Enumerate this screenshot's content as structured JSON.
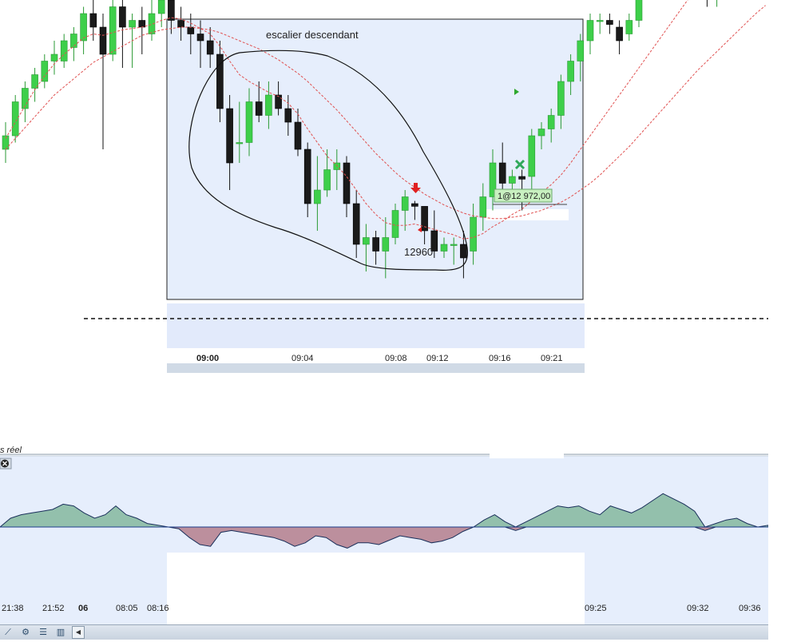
{
  "annotations": {
    "title": "escalier descendant",
    "price_label": "12960",
    "order_tag": "1@12 972,00"
  },
  "indicator": {
    "label": "s réel"
  },
  "toolbar": {
    "icons": [
      "line-tool-icon",
      "settings-icon",
      "list-icon",
      "bars-icon",
      "scroll-left-icon"
    ]
  },
  "colors": {
    "bull": "#3ecf4a",
    "bear": "#1a1a1a",
    "ma": "#e05050",
    "area_pos": "#4f9a6a",
    "area_neg": "#a0505e",
    "panel_bg": "#e6eefc"
  },
  "chart_data": [
    {
      "type": "candlestick",
      "x_top": [
        "09:00",
        "09:04",
        "09:08",
        "09:12",
        "09:16",
        "09:21"
      ],
      "x_bottom": [
        "21:38",
        "21:52",
        "06",
        "08:05",
        "08:16",
        "09:25",
        "09:32",
        "09:36"
      ],
      "ylim": [
        12900,
        13100
      ],
      "candles": [
        [
          12990,
          13010,
          12980,
          13000
        ],
        [
          13000,
          13030,
          12995,
          13025
        ],
        [
          13020,
          13040,
          13010,
          13035
        ],
        [
          13035,
          13050,
          13025,
          13045
        ],
        [
          13040,
          13060,
          13035,
          13055
        ],
        [
          13055,
          13070,
          13045,
          13060
        ],
        [
          13055,
          13075,
          13050,
          13070
        ],
        [
          13065,
          13080,
          13055,
          13075
        ],
        [
          13070,
          13095,
          13060,
          13090
        ],
        [
          13090,
          13100,
          13070,
          13080
        ],
        [
          13080,
          13090,
          12990,
          13060
        ],
        [
          13060,
          13100,
          13055,
          13095
        ],
        [
          13095,
          13105,
          13050,
          13080
        ],
        [
          13080,
          13090,
          13050,
          13085
        ],
        [
          13085,
          13095,
          13060,
          13080
        ],
        [
          13075,
          13100,
          13070,
          13090
        ],
        [
          13090,
          13105,
          13080,
          13100
        ],
        [
          13100,
          13110,
          13075,
          13085
        ],
        [
          13085,
          13095,
          13070,
          13080
        ],
        [
          13080,
          13090,
          13060,
          13075
        ],
        [
          13075,
          13085,
          13050,
          13070
        ],
        [
          13070,
          13080,
          13050,
          13060
        ],
        [
          13060,
          13070,
          13010,
          13020
        ],
        [
          13020,
          13030,
          12960,
          12980
        ],
        [
          12995,
          13025,
          12980,
          12995
        ],
        [
          12995,
          13035,
          12985,
          13025
        ],
        [
          13025,
          13040,
          13010,
          13015
        ],
        [
          13015,
          13040,
          13005,
          13030
        ],
        [
          13030,
          13040,
          13015,
          13020
        ],
        [
          13020,
          13030,
          13000,
          13010
        ],
        [
          13010,
          13020,
          12985,
          12990
        ],
        [
          12990,
          12995,
          12940,
          12950
        ],
        [
          12950,
          12985,
          12930,
          12960
        ],
        [
          12960,
          12990,
          12955,
          12975
        ],
        [
          12975,
          12990,
          12960,
          12980
        ],
        [
          12980,
          12985,
          12940,
          12950
        ],
        [
          12950,
          12960,
          12910,
          12920
        ],
        [
          12920,
          12935,
          12900,
          12925
        ],
        [
          12925,
          12930,
          12905,
          12915
        ],
        [
          12915,
          12940,
          12895,
          12925
        ],
        [
          12925,
          12950,
          12920,
          12945
        ],
        [
          12945,
          12960,
          12930,
          12955
        ],
        [
          12950,
          12952,
          12938,
          12948
        ],
        [
          12948,
          12945,
          12920,
          12930
        ],
        [
          12930,
          12945,
          12910,
          12915
        ],
        [
          12915,
          12925,
          12910,
          12920
        ],
        [
          12920,
          12925,
          12905,
          12920
        ],
        [
          12920,
          12930,
          12895,
          12910
        ],
        [
          12915,
          12950,
          12905,
          12940
        ],
        [
          12940,
          12965,
          12930,
          12955
        ],
        [
          12955,
          12990,
          12945,
          12980
        ],
        [
          12980,
          12995,
          12955,
          12965
        ],
        [
          12965,
          12975,
          12955,
          12970
        ],
        [
          12970,
          12975,
          12945,
          12968
        ],
        [
          12970,
          13005,
          12960,
          13000
        ],
        [
          13000,
          13010,
          12990,
          13005
        ],
        [
          13005,
          13020,
          12995,
          13015
        ],
        [
          13015,
          13045,
          13005,
          13040
        ],
        [
          13040,
          13060,
          13030,
          13055
        ],
        [
          13055,
          13075,
          13040,
          13070
        ],
        [
          13070,
          13090,
          13060,
          13085
        ],
        [
          13085,
          13090,
          13075,
          13085
        ],
        [
          13085,
          13090,
          13075,
          13082
        ],
        [
          13080,
          13085,
          13060,
          13070
        ],
        [
          13075,
          13090,
          13070,
          13085
        ],
        [
          13085,
          13110,
          13080,
          13105
        ],
        [
          13105,
          13120,
          13100,
          13115
        ],
        [
          13115,
          13130,
          13105,
          13120
        ],
        [
          13120,
          13140,
          13110,
          13135
        ],
        [
          13135,
          13160,
          13125,
          13155
        ],
        [
          13155,
          13180,
          13145,
          13170
        ],
        [
          13170,
          13200,
          13160,
          13190
        ],
        [
          13170,
          13185,
          13095,
          13120
        ],
        [
          13120,
          13150,
          13095,
          13135
        ],
        [
          13135,
          13145,
          13120,
          13135
        ],
        [
          13135,
          13155,
          13125,
          13150
        ],
        [
          13150,
          13165,
          13140,
          13160
        ],
        [
          13160,
          13175,
          13150,
          13155
        ],
        [
          13150,
          13155,
          13110,
          13125
        ]
      ],
      "ma_fast": [
        12998,
        13010,
        13022,
        13034,
        13044,
        13053,
        13060,
        13066,
        13072,
        13075,
        13074,
        13076,
        13078,
        13079,
        13080,
        13082,
        13085,
        13087,
        13086,
        13083,
        13079,
        13075,
        13066,
        13055,
        13045,
        13040,
        13036,
        13032,
        13029,
        13024,
        13016,
        13005,
        12995,
        12985,
        12978,
        12970,
        12960,
        12950,
        12942,
        12936,
        12934,
        12934,
        12935,
        12933,
        12931,
        12929,
        12927,
        12924,
        12925,
        12928,
        12933,
        12937,
        12942,
        12946,
        12952,
        12958,
        12964,
        12971,
        12980,
        12990,
        13000,
        13010,
        13020,
        13030,
        13040,
        13050,
        13060,
        13070,
        13080,
        13090,
        13100,
        13110,
        13112,
        13115,
        13118,
        13122,
        13126,
        13130,
        13130
      ],
      "ma_slow": [
        12990,
        12998,
        13006,
        13014,
        13022,
        13030,
        13036,
        13042,
        13048,
        13054,
        13058,
        13062,
        13066,
        13070,
        13074,
        13076,
        13078,
        13079,
        13080,
        13080,
        13079,
        13078,
        13076,
        13073,
        13070,
        13067,
        13064,
        13060,
        13056,
        13051,
        13046,
        13040,
        13033,
        13026,
        13019,
        13011,
        13003,
        12995,
        12987,
        12980,
        12973,
        12967,
        12962,
        12957,
        12953,
        12949,
        12946,
        12943,
        12941,
        12940,
        12939,
        12939,
        12940,
        12941,
        12943,
        12945,
        12948,
        12951,
        12955,
        12960,
        12965,
        12971,
        12978,
        12985,
        12992,
        13000,
        13008,
        13016,
        13024,
        13032,
        13040,
        13048,
        13055,
        13062,
        13069,
        13076,
        13083,
        13090,
        13096
      ],
      "indicator_values": [
        0,
        10,
        14,
        16,
        18,
        20,
        26,
        24,
        16,
        10,
        14,
        24,
        14,
        10,
        4,
        2,
        0,
        -2,
        -12,
        -20,
        -22,
        -6,
        -4,
        -6,
        -8,
        -10,
        -12,
        -16,
        -22,
        -18,
        -10,
        -12,
        -20,
        -24,
        -18,
        -18,
        -20,
        -15,
        -10,
        -12,
        -14,
        -18,
        -16,
        -12,
        -5,
        0,
        8,
        14,
        6,
        -4,
        6,
        12,
        18,
        24,
        22,
        24,
        18,
        14,
        24,
        20,
        16,
        22,
        30,
        38,
        32,
        26,
        18,
        -4,
        4,
        8,
        10,
        4,
        0,
        2
      ]
    }
  ]
}
